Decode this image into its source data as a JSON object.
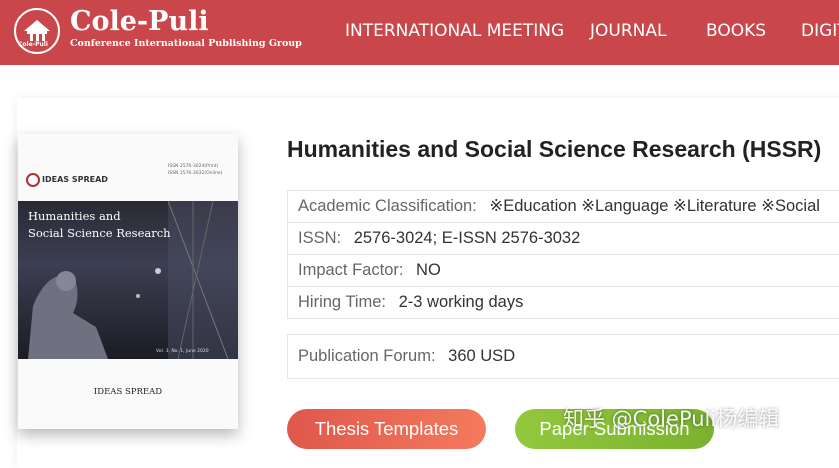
{
  "header": {
    "logo_name": "Cole-Puli",
    "logo_subtitle": "Conference International Publishing Group",
    "logo_ring_text": "Cole-Puli",
    "nav": [
      "INTERNATIONAL MEETING",
      "JOURNAL",
      "BOOKS",
      "DIGITAL"
    ],
    "bg_color": "#c9474b"
  },
  "cover": {
    "brand": "IDEAS SPREAD",
    "issn_lines": [
      "ISSN 2576-3024(Print)",
      "ISSN 2576-3032(Online)"
    ],
    "title_line1": "Humanities and",
    "title_line2": "Social Science Research",
    "issue": "Vol. 3, No. 1, June 2020",
    "publisher": "IDEAS SPREAD"
  },
  "journal": {
    "title": "Humanities and Social Science Research (HSSR)",
    "info": [
      {
        "label": "Academic Classification:",
        "value": "※Education ※Language ※Literature ※Social"
      },
      {
        "label": "ISSN:",
        "value": "2576-3024; E-ISSN 2576-3032"
      },
      {
        "label": "Impact Factor:",
        "value": "NO"
      },
      {
        "label": "Hiring Time:",
        "value": "2-3 working days"
      }
    ],
    "forum": {
      "label": "Publication Forum:",
      "value": "360 USD"
    }
  },
  "buttons": {
    "thesis": "Thesis Templates",
    "paper": "Paper Submission"
  },
  "watermark": "知乎 @ColePuli杨编辑"
}
